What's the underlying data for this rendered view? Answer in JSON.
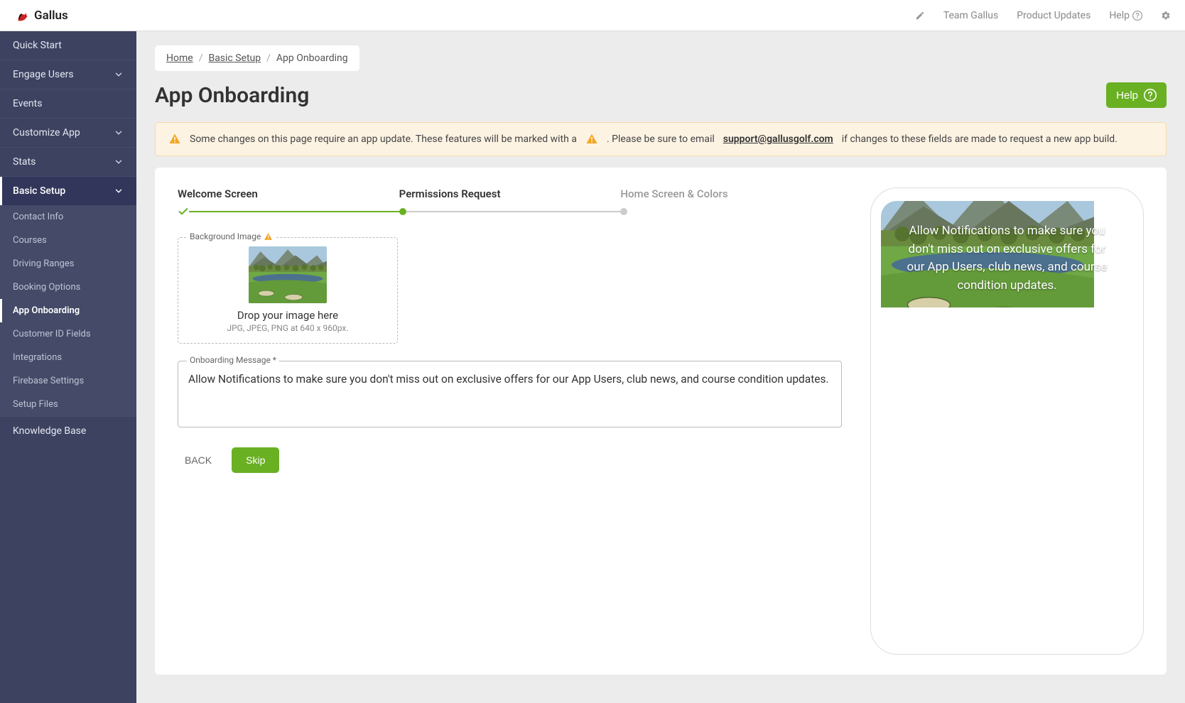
{
  "brand": {
    "name": "Gallus"
  },
  "topnav": {
    "team": "Team Gallus",
    "updates": "Product Updates",
    "help": "Help"
  },
  "sidebar": {
    "quick_start": "Quick Start",
    "engage": "Engage Users",
    "events": "Events",
    "customize": "Customize App",
    "stats": "Stats",
    "basic_setup": "Basic Setup",
    "subs": {
      "contact": "Contact Info",
      "courses": "Courses",
      "ranges": "Driving Ranges",
      "booking": "Booking Options",
      "onboarding": "App Onboarding",
      "customer_id": "Customer ID Fields",
      "integrations": "Integrations",
      "firebase": "Firebase Settings",
      "setup_files": "Setup Files"
    },
    "kb": "Knowledge Base"
  },
  "breadcrumbs": {
    "home": "Home",
    "basic": "Basic Setup",
    "current": "App Onboarding"
  },
  "page": {
    "title": "App Onboarding",
    "help_btn": "Help"
  },
  "alert": {
    "part1": "Some changes on this page require an app update. These features will be marked with a",
    "part2": ". Please be sure to email",
    "email": "support@gallusgolf.com",
    "part3": "if changes to these fields are made to request a new app build."
  },
  "stepper": {
    "step1": "Welcome Screen",
    "step2": "Permissions Request",
    "step3": "Home Screen & Colors"
  },
  "bg_image": {
    "legend": "Background Image",
    "drop_text": "Drop your image here",
    "sub_text": "JPG, JPEG, PNG at 640 x 960px."
  },
  "message": {
    "legend": "Onboarding Message *",
    "value": "Allow Notifications to make sure you don't miss out on exclusive offers for our App Users, club news, and course condition updates."
  },
  "buttons": {
    "back": "BACK",
    "skip": "Skip"
  },
  "preview": {
    "text": "Allow Notifications to make sure you don't miss out on exclusive offers for our App Users, club news, and course condition updates."
  }
}
